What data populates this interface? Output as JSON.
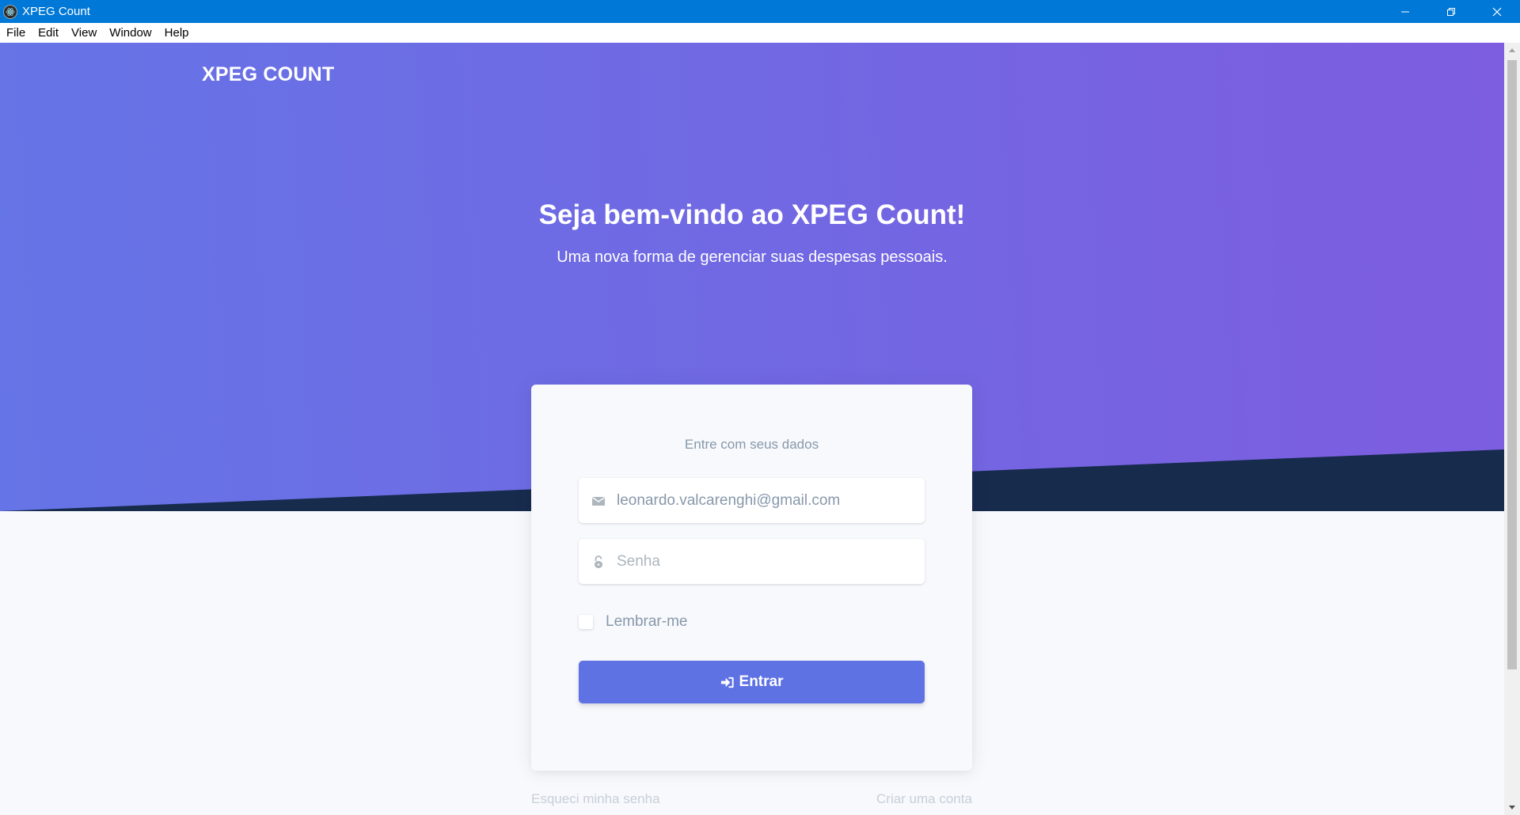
{
  "window": {
    "title": "XPEG Count",
    "icon": "electron-atom-icon",
    "controls": [
      "minimize-icon",
      "restore-icon",
      "close-icon"
    ]
  },
  "menu": {
    "items": [
      "File",
      "Edit",
      "View",
      "Window",
      "Help"
    ]
  },
  "navbar": {
    "brand": "XPEG COUNT"
  },
  "hero": {
    "title": "Seja bem-vindo ao XPEG Count!",
    "subtitle": "Uma nova forma de gerenciar suas despesas pessoais."
  },
  "login": {
    "heading": "Entre com seus dados",
    "email": {
      "value": "leonardo.valcarenghi@gmail.com",
      "icon": "envelope-icon"
    },
    "password": {
      "placeholder": "Senha",
      "icon": "lock-icon"
    },
    "remember_label": "Lembrar-me",
    "remember_checked": false,
    "submit_label": "Entrar",
    "submit_icon": "sign-in-icon"
  },
  "links": {
    "forgot": "Esqueci minha senha",
    "register": "Criar uma conta"
  },
  "colors": {
    "titlebar": "#0078d7",
    "hero_start": "#6574e6",
    "hero_end": "#7d5de0",
    "hero_dark": "#172b4d",
    "primary": "#5e72e4",
    "muted": "#8898aa",
    "background": "#f7f9fc"
  }
}
